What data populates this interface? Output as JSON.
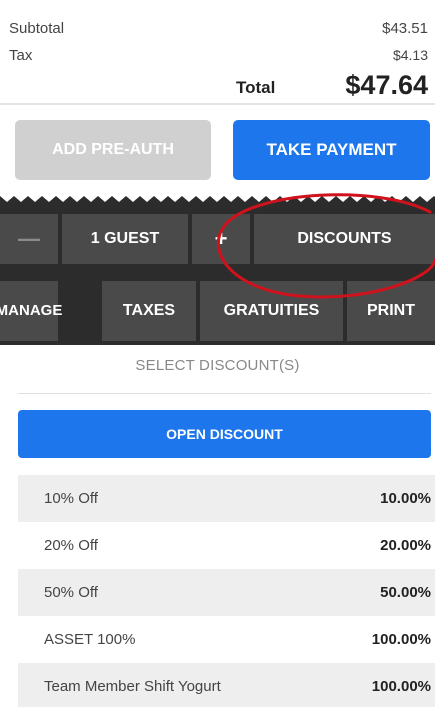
{
  "totals": {
    "subtotal_label": "Subtotal",
    "subtotal_value": "$43.51",
    "tax_label": "Tax",
    "tax_value": "$4.13",
    "total_label": "Total",
    "total_value": "$47.64"
  },
  "actions": {
    "preauth_label": "ADD PRE-AUTH",
    "pay_label": "TAKE PAYMENT"
  },
  "toolbar": {
    "minus_label": "—",
    "guest_label": "1 GUEST",
    "plus_label": "+",
    "discounts_label": "DISCOUNTS",
    "manage_line1": "MANAG",
    "manage_line2": "E",
    "taxes_label": "TAXES",
    "gratuities_label": "GRATUITIES",
    "print_label": "PRINT"
  },
  "discounts": {
    "title": "SELECT DISCOUNT(S)",
    "open_label": "OPEN DISCOUNT",
    "items": [
      {
        "name": "10% Off",
        "value": "10.00%"
      },
      {
        "name": "20% Off",
        "value": "20.00%"
      },
      {
        "name": "50% Off",
        "value": "50.00%"
      },
      {
        "name": "ASSET 100%",
        "value": "100.00%"
      },
      {
        "name": "Team Member Shift Yogurt",
        "value": "100.00%"
      }
    ]
  },
  "colors": {
    "accent_blue": "#1d76ec",
    "disabled_gray": "#d0d0d0",
    "toolbar_dark": "#2c2c2c",
    "annotation_red": "#d0121c"
  }
}
